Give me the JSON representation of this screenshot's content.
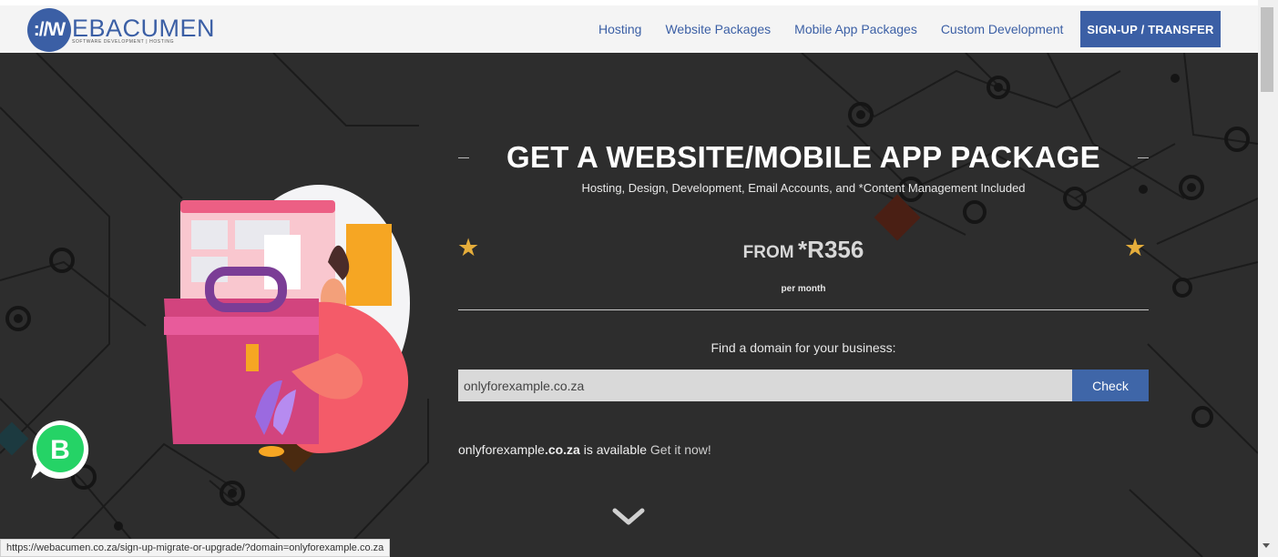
{
  "header": {
    "logo_mark": "://W",
    "logo_word": "EBACUMEN",
    "logo_tagline": "SOFTWARE DEVELOPMENT | HOSTING",
    "nav": [
      "Hosting",
      "Website Packages",
      "Mobile App Packages",
      "Custom Development"
    ],
    "signup_label": "SIGN-UP / TRANSFER"
  },
  "hero": {
    "title": "GET A WEBSITE/MOBILE APP PACKAGE",
    "subtitle": "Hosting, Design, Development, Email Accounts, and *Content Management Included",
    "price_from": "FROM",
    "price_value": "*R356",
    "per_month": "per month",
    "star_icon": "★",
    "find_label": "Find a domain for your business:",
    "domain_value": "onlyforexample.co.za",
    "check_label": "Check",
    "availability": {
      "name": "onlyforexample",
      "tld": ".co.za",
      "status": " is available ",
      "link": "Get it now!"
    }
  },
  "whatsapp": {
    "letter": "B"
  },
  "status_bar": {
    "url": "https://webacumen.co.za/sign-up-migrate-or-upgrade/?domain=onlyforexample.co.za"
  },
  "colors": {
    "brand": "#3b5fa5",
    "accent": "#e5ad3b",
    "hero_bg": "#2d2d2d",
    "whatsapp": "#25d366"
  }
}
